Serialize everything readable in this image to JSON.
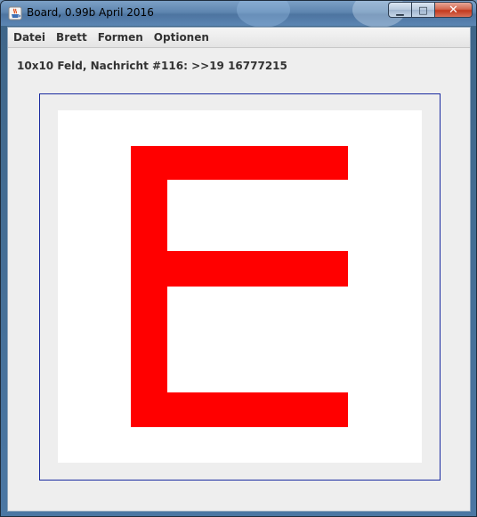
{
  "window": {
    "title": "Board, 0.99b April 2016",
    "minimize_glyph": "▁",
    "maximize_glyph": "□",
    "close_glyph": "✕"
  },
  "menu": {
    "items": [
      "Datei",
      "Brett",
      "Formen",
      "Optionen"
    ]
  },
  "status": {
    "text": "10x10 Feld, Nachricht #116: >>19 16777215"
  },
  "board": {
    "shape_color": "#ff0000",
    "background_color": "#ffffff",
    "frame_color": "#1a2aa0"
  },
  "icons": {
    "app_icon": "java-cup-icon"
  }
}
